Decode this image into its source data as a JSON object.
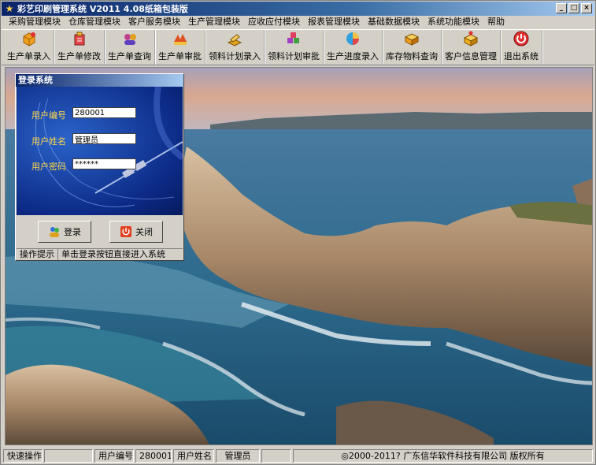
{
  "window": {
    "title": "彩艺印刷管理系统  V2011 4.08纸箱包装版",
    "minimize": "_",
    "maximize": "□",
    "close": "×"
  },
  "menu": [
    "采购管理模块",
    "仓库管理模块",
    "客户服务模块",
    "生产管理模块",
    "应收应付模块",
    "报表管理模块",
    "基础数据模块",
    "系统功能模块",
    "帮助"
  ],
  "toolbar": [
    {
      "label": "生产单录入",
      "icon": "box-plus-icon",
      "color": "#f0a020"
    },
    {
      "label": "生产单修改",
      "icon": "box-edit-icon",
      "color": "#e04848"
    },
    {
      "label": "生产单查询",
      "icon": "people-search-icon",
      "color": "#c04090"
    },
    {
      "label": "生产单审批",
      "icon": "approve-icon",
      "color": "#e05020"
    },
    {
      "label": "领料计划录入",
      "icon": "material-plan-icon",
      "color": "#e0a020"
    },
    {
      "label": "领料计划审批",
      "icon": "material-approve-icon",
      "color": "#a040c0"
    },
    {
      "label": "生产进度录入",
      "icon": "pie-chart-icon",
      "color": "#30a0e0"
    },
    {
      "label": "库存物料查询",
      "icon": "stock-search-icon",
      "color": "#f0a020"
    },
    {
      "label": "客户信息管理",
      "icon": "customer-icon",
      "color": "#f0b020"
    },
    {
      "label": "退出系统",
      "icon": "power-icon",
      "color": "#e03030"
    }
  ],
  "login": {
    "title": "登录系统",
    "user_id_label": "用户编号",
    "user_id_value": "280001",
    "user_name_label": "用户姓名",
    "user_name_value": "管理员",
    "password_label": "用户密码",
    "password_value": "******",
    "login_button": "登录",
    "close_button": "关闭",
    "hint_label": "操作提示",
    "hint_text": "单击登录按钮直接进入系统"
  },
  "status": {
    "quick_ops": "快速操作",
    "user_id_label": "用户编号",
    "user_id": "280001",
    "user_name_label": "用户姓名",
    "user_name": "管理员",
    "copyright": "◎2000-2011?   广东信华软件科技有限公司    版权所有"
  }
}
